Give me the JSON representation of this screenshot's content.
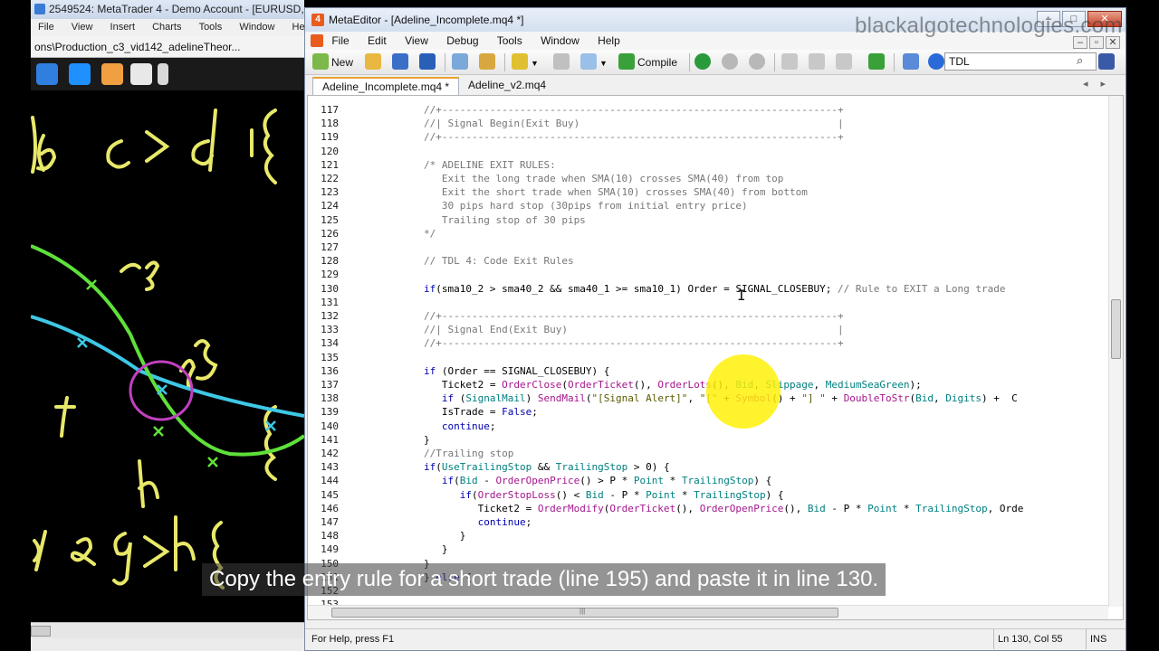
{
  "mt4": {
    "title": "2549524: MetaTrader 4 - Demo Account - [EURUSD,H1 (",
    "menu": [
      "File",
      "View",
      "Insert",
      "Charts",
      "Tools",
      "Window",
      "Help"
    ],
    "doc_path": "ons\\Production_c3_vid142_adelineTheor..."
  },
  "metaeditor": {
    "title": "MetaEditor - [Adeline_Incomplete.mq4 *]",
    "menu": [
      "File",
      "Edit",
      "View",
      "Debug",
      "Tools",
      "Window",
      "Help"
    ],
    "toolbar": {
      "new_label": "New",
      "compile_label": "Compile"
    },
    "search": {
      "value": "TDL"
    },
    "tabs": [
      {
        "label": "Adeline_Incomplete.mq4 *",
        "active": true
      },
      {
        "label": "Adeline_v2.mq4",
        "active": false
      }
    ],
    "status": {
      "help": "For Help, press F1",
      "position": "Ln 130, Col 55",
      "mode": "INS"
    }
  },
  "code": {
    "lines": [
      {
        "n": "117",
        "t": "//+------------------------------------------------------------------+"
      },
      {
        "n": "118",
        "t": "//| Signal Begin(Exit Buy)                                           |"
      },
      {
        "n": "119",
        "t": "//+------------------------------------------------------------------+"
      },
      {
        "n": "120",
        "t": ""
      },
      {
        "n": "121",
        "t": "/* ADELINE EXIT RULES:"
      },
      {
        "n": "122",
        "t": "   Exit the long trade when SMA(10) crosses SMA(40) from top"
      },
      {
        "n": "123",
        "t": "   Exit the short trade when SMA(10) crosses SMA(40) from bottom"
      },
      {
        "n": "124",
        "t": "   30 pips hard stop (30pips from initial entry price)"
      },
      {
        "n": "125",
        "t": "   Trailing stop of 30 pips"
      },
      {
        "n": "126",
        "t": "*/"
      },
      {
        "n": "127",
        "t": ""
      },
      {
        "n": "128",
        "t": "// TDL 4: Code Exit Rules"
      },
      {
        "n": "129",
        "t": ""
      },
      {
        "n": "130",
        "t": "if(sma10_2 > sma40_2 && sma40_1 >= sma10_1) Order = SIGNAL_CLOSEBUY; // Rule to EXIT a Long trade"
      },
      {
        "n": "131",
        "t": ""
      },
      {
        "n": "132",
        "t": "//+------------------------------------------------------------------+"
      },
      {
        "n": "133",
        "t": "//| Signal End(Exit Buy)                                             |"
      },
      {
        "n": "134",
        "t": "//+------------------------------------------------------------------+"
      },
      {
        "n": "135",
        "t": ""
      },
      {
        "n": "136",
        "t": "if (Order == SIGNAL_CLOSEBUY) {"
      },
      {
        "n": "137",
        "t": "   Ticket2 = OrderClose(OrderTicket(), OrderLots(), Bid, Slippage, MediumSeaGreen);"
      },
      {
        "n": "138",
        "t": "   if (SignalMail) SendMail(\"[Signal Alert]\", \"[\" + Symbol() + \"] \" + DoubleToStr(Bid, Digits) + \" C"
      },
      {
        "n": "139",
        "t": "   IsTrade = False;"
      },
      {
        "n": "140",
        "t": "   continue;"
      },
      {
        "n": "141",
        "t": "}"
      },
      {
        "n": "142",
        "t": "//Trailing stop"
      },
      {
        "n": "143",
        "t": "if(UseTrailingStop && TrailingStop > 0) {"
      },
      {
        "n": "144",
        "t": "   if(Bid - OrderOpenPrice() > P * Point * TrailingStop) {"
      },
      {
        "n": "145",
        "t": "      if(OrderStopLoss() < Bid - P * Point * TrailingStop) {"
      },
      {
        "n": "146",
        "t": "         Ticket2 = OrderModify(OrderTicket(), OrderOpenPrice(), Bid - P * Point * TrailingStop, Orde"
      },
      {
        "n": "147",
        "t": "         continue;"
      },
      {
        "n": "148",
        "t": "      }"
      },
      {
        "n": "149",
        "t": "   }"
      },
      {
        "n": "150",
        "t": "}"
      },
      {
        "n": "151",
        "t": "} else {"
      },
      {
        "n": "152",
        "t": ""
      },
      {
        "n": "153",
        "t": ""
      },
      {
        "n": "154",
        "t": "//+------------------------------------------------------------------+"
      }
    ]
  },
  "overlay": {
    "watermark": "blackalgotechnologies.com",
    "subtitle": "Copy the entry rule for a short trade (line 195) and paste it in line 130."
  },
  "colors": {
    "highlight": "#FFF000",
    "drawing_cyan": "#3EC8E6",
    "drawing_green": "#5FE03A",
    "drawing_yellow": "#E8E86A",
    "drawing_magenta": "#C040C0"
  }
}
